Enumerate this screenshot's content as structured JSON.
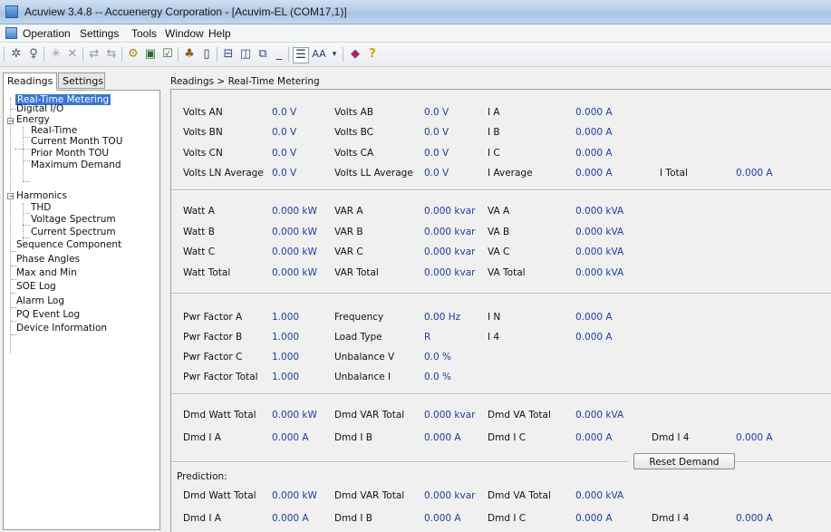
{
  "window": {
    "title": "Acuview 3.4.8 -- Accuenergy Corporation - [Acuvim-EL (COM17,1)]"
  },
  "menu": [
    "Operation",
    "Settings",
    "Tools",
    "Window",
    "Help"
  ],
  "left_tabs": [
    "Readings",
    "Settings"
  ],
  "tree": {
    "real_time_metering": "Real-Time Metering",
    "digital_io": "Digital I/O",
    "energy": "Energy",
    "real_time": "Real-Time",
    "current_month_tou": "Current Month TOU",
    "prior_month_tou": "Prior Month TOU",
    "maximum_demand": "Maximum Demand",
    "harmonics": "Harmonics",
    "thd": "THD",
    "voltage_spectrum": "Voltage Spectrum",
    "current_spectrum": "Current Spectrum",
    "sequence_component": "Sequence Component",
    "phase_angles": "Phase Angles",
    "max_and_min": "Max and Min",
    "soe_log": "SOE Log",
    "alarm_log": "Alarm Log",
    "pq_event_log": "PQ Event Log",
    "device_information": "Device Information"
  },
  "breadcrumb": "Readings > Real-Time Metering",
  "readings": {
    "volts_an": {
      "label": "Volts AN",
      "value": "0.0 V"
    },
    "volts_bn": {
      "label": "Volts BN",
      "value": "0.0 V"
    },
    "volts_cn": {
      "label": "Volts CN",
      "value": "0.0 V"
    },
    "volts_ln_avg": {
      "label": "Volts LN Average",
      "value": "0.0 V"
    },
    "volts_ab": {
      "label": "Volts AB",
      "value": "0.0 V"
    },
    "volts_bc": {
      "label": "Volts BC",
      "value": "0.0 V"
    },
    "volts_ca": {
      "label": "Volts CA",
      "value": "0.0 V"
    },
    "volts_ll_avg": {
      "label": "Volts LL Average",
      "value": "0.0 V"
    },
    "i_a": {
      "label": "I A",
      "value": "0.000 A"
    },
    "i_b": {
      "label": "I B",
      "value": "0.000 A"
    },
    "i_c": {
      "label": "I C",
      "value": "0.000 A"
    },
    "i_avg": {
      "label": "I Average",
      "value": "0.000 A"
    },
    "i_total": {
      "label": "I Total",
      "value": "0.000 A"
    },
    "watt_a": {
      "label": "Watt A",
      "value": "0.000 kW"
    },
    "watt_b": {
      "label": "Watt B",
      "value": "0.000 kW"
    },
    "watt_c": {
      "label": "Watt C",
      "value": "0.000 kW"
    },
    "watt_total": {
      "label": "Watt Total",
      "value": "0.000 kW"
    },
    "var_a": {
      "label": "VAR A",
      "value": "0.000 kvar"
    },
    "var_b": {
      "label": "VAR B",
      "value": "0.000 kvar"
    },
    "var_c": {
      "label": "VAR C",
      "value": "0.000 kvar"
    },
    "var_total": {
      "label": "VAR Total",
      "value": "0.000 kvar"
    },
    "va_a": {
      "label": "VA A",
      "value": "0.000 kVA"
    },
    "va_b": {
      "label": "VA B",
      "value": "0.000 kVA"
    },
    "va_c": {
      "label": "VA C",
      "value": "0.000 kVA"
    },
    "va_total": {
      "label": "VA Total",
      "value": "0.000 kVA"
    },
    "pf_a": {
      "label": "Pwr Factor A",
      "value": "1.000"
    },
    "pf_b": {
      "label": "Pwr Factor B",
      "value": "1.000"
    },
    "pf_c": {
      "label": "Pwr Factor C",
      "value": "1.000"
    },
    "pf_total": {
      "label": "Pwr Factor Total",
      "value": "1.000"
    },
    "frequency": {
      "label": "Frequency",
      "value": "0.00 Hz"
    },
    "load_type": {
      "label": "Load Type",
      "value": "R"
    },
    "unbalance_v": {
      "label": "Unbalance V",
      "value": "0.0 %"
    },
    "unbalance_i": {
      "label": "Unbalance I",
      "value": "0.0 %"
    },
    "i_n": {
      "label": "I N",
      "value": "0.000 A"
    },
    "i_4": {
      "label": "I 4",
      "value": "0.000 A"
    }
  },
  "demand": {
    "dmd_watt_total": {
      "label": "Dmd Watt Total",
      "value": "0.000 kW"
    },
    "dmd_var_total": {
      "label": "Dmd VAR Total",
      "value": "0.000 kvar"
    },
    "dmd_va_total": {
      "label": "Dmd VA Total",
      "value": "0.000 kVA"
    },
    "dmd_i_a": {
      "label": "Dmd I A",
      "value": "0.000 A"
    },
    "dmd_i_b": {
      "label": "Dmd I B",
      "value": "0.000 A"
    },
    "dmd_i_c": {
      "label": "Dmd I C",
      "value": "0.000 A"
    },
    "dmd_i_4": {
      "label": "Dmd I 4",
      "value": "0.000 A"
    },
    "reset_label": "Reset Demand"
  },
  "prediction": {
    "heading": "Prediction:",
    "dmd_watt_total": {
      "label": "Dmd Watt Total",
      "value": "0.000 kW"
    },
    "dmd_var_total": {
      "label": "Dmd VAR Total",
      "value": "0.000 kvar"
    },
    "dmd_va_total": {
      "label": "Dmd VA Total",
      "value": "0.000 kVA"
    },
    "dmd_i_a": {
      "label": "Dmd I A",
      "value": "0.000 A"
    },
    "dmd_i_b": {
      "label": "Dmd I B",
      "value": "0.000 A"
    },
    "dmd_i_c": {
      "label": "Dmd I C",
      "value": "0.000 A"
    },
    "dmd_i_4": {
      "label": "Dmd I 4",
      "value": "0.000 A"
    }
  }
}
